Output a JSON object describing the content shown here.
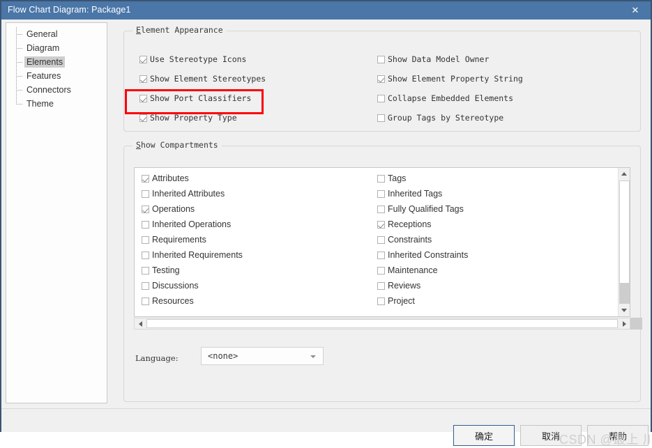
{
  "window": {
    "title": "Flow Chart Diagram: Package1",
    "close_icon": "close-icon",
    "close_glyph": "✕",
    "titlebar_color": "#4a76a8",
    "border_color": "#3a5571",
    "background_color": "#f0f0f0"
  },
  "sidebar": {
    "items": [
      {
        "label": "General",
        "selected": false
      },
      {
        "label": "Diagram",
        "selected": false
      },
      {
        "label": "Elements",
        "selected": true
      },
      {
        "label": "Features",
        "selected": false
      },
      {
        "label": "Connectors",
        "selected": false
      },
      {
        "label": "Theme",
        "selected": false
      }
    ],
    "selected_label": "Elements"
  },
  "element_appearance": {
    "group_title": "Element Appearance",
    "accelerator": "E",
    "left_column": [
      {
        "label": "Use Stereotype Icons",
        "checked": true
      },
      {
        "label": "Show Element Stereotypes",
        "checked": true
      },
      {
        "label": "Show Port Classifiers",
        "checked": true
      },
      {
        "label": "Show Property Type",
        "checked": true
      }
    ],
    "right_column": [
      {
        "label": "Show Data Model Owner",
        "checked": false
      },
      {
        "label": "Show Element Property String",
        "checked": true
      },
      {
        "label": "Collapse Embedded Elements",
        "checked": false
      },
      {
        "label": "Group Tags by Stereotype",
        "checked": false
      }
    ]
  },
  "highlight": {
    "target_label": "Show Element Stereotypes",
    "color": "#fb0007"
  },
  "show_compartments": {
    "group_title": "Show Compartments",
    "accelerator": "S",
    "left_column": [
      {
        "label": "Attributes",
        "checked": true
      },
      {
        "label": "Inherited Attributes",
        "checked": false
      },
      {
        "label": "Operations",
        "checked": true
      },
      {
        "label": "Inherited Operations",
        "checked": false
      },
      {
        "label": "Requirements",
        "checked": false
      },
      {
        "label": "Inherited Requirements",
        "checked": false
      },
      {
        "label": "Testing",
        "checked": false
      },
      {
        "label": "Discussions",
        "checked": false
      },
      {
        "label": "Resources",
        "checked": false
      }
    ],
    "right_column": [
      {
        "label": "Tags",
        "checked": false
      },
      {
        "label": "Inherited Tags",
        "checked": false
      },
      {
        "label": "Fully Qualified Tags",
        "checked": false
      },
      {
        "label": "Receptions",
        "checked": true
      },
      {
        "label": "Constraints",
        "checked": false
      },
      {
        "label": "Inherited Constraints",
        "checked": false
      },
      {
        "label": "Maintenance",
        "checked": false
      },
      {
        "label": "Reviews",
        "checked": false
      },
      {
        "label": "Project",
        "checked": false
      }
    ],
    "scrollbars": {
      "vertical_icons": [
        "chevron-up-icon",
        "chevron-down-icon"
      ],
      "horizontal_icons": [
        "chevron-left-icon",
        "chevron-right-icon"
      ]
    }
  },
  "language": {
    "label": "Language:",
    "value": "<none>",
    "placeholder": "<none>",
    "options": [
      "<none>"
    ],
    "arrow_icon": "chevron-down-icon"
  },
  "footer": {
    "ok_label": "确定",
    "cancel_label": "取消",
    "help_label": "帮助"
  },
  "watermark": {
    "text": "CSDN @最上 川"
  }
}
